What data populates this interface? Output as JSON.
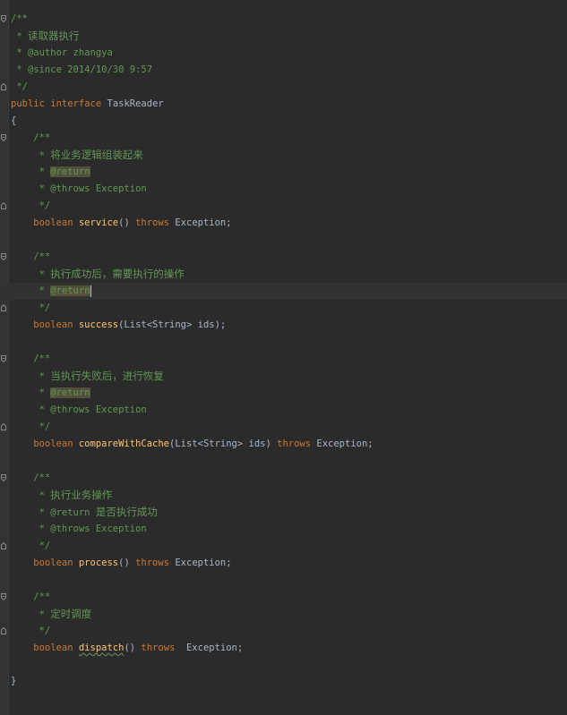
{
  "editor": {
    "lines": {
      "l1": "/**",
      "l2_star": " * ",
      "l2_text": "读取器执行",
      "l3": " * @author zhangya",
      "l4": " * @since 2014/10/30 9:57",
      "l5": " */",
      "l6_kw1": "public",
      "l6_kw2": "interface",
      "l6_name": "TaskReader",
      "l7": "{",
      "l8": "    /**",
      "l9_star": "     * ",
      "l9_text": "将业务逻辑组装起来",
      "l10_star": "     * ",
      "l10_tag": "@return",
      "l11": "     * @throws Exception",
      "l12": "     */",
      "l13_kw": "    boolean ",
      "l13_fn": "service",
      "l13_mid": "() ",
      "l13_kw2": "throws",
      "l13_end": " Exception;",
      "l15": "    /**",
      "l16_star": "     * ",
      "l16_text": "执行成功后，需要执行的操作",
      "l17_star": "     * ",
      "l17_tag": "@return",
      "l18": "     */",
      "l19_kw": "    boolean ",
      "l19_fn": "success",
      "l19_end": "(List<String> ids);",
      "l21": "    /**",
      "l22_star": "     * ",
      "l22_text": "当执行失败后，进行恢复",
      "l23_star": "     * ",
      "l23_tag": "@return",
      "l24": "     * @throws Exception",
      "l25": "     */",
      "l26_kw": "    boolean ",
      "l26_fn": "compareWithCache",
      "l26_mid": "(List<String> ids) ",
      "l26_kw2": "throws",
      "l26_end": " Exception;",
      "l28": "    /**",
      "l29_star": "     * ",
      "l29_text": "执行业务操作",
      "l30_star": "     * @return ",
      "l30_text": "是否执行成功",
      "l31": "     * @throws Exception",
      "l32": "     */",
      "l33_kw": "    boolean ",
      "l33_fn": "process",
      "l33_mid": "() ",
      "l33_kw2": "throws",
      "l33_end": " Exception;",
      "l35": "    /**",
      "l36_star": "     * ",
      "l36_text": "定时调度",
      "l37": "     */",
      "l38_kw": "    boolean ",
      "l38_fn": "dispatch",
      "l38_mid": "() ",
      "l38_kw2": "throws",
      "l38_end": "  Exception;",
      "l40": "}"
    }
  }
}
